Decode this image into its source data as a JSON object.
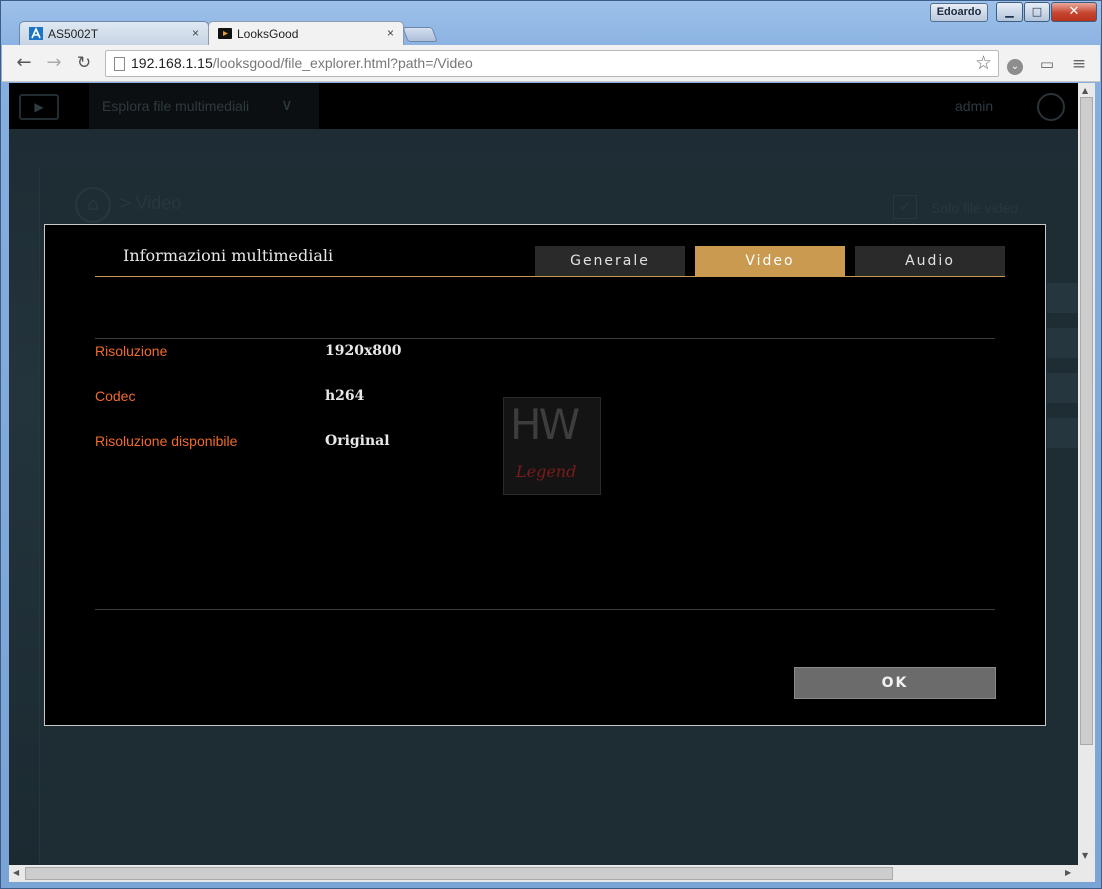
{
  "window": {
    "user_badge": "Edoardo",
    "minimize_glyph": "▁",
    "maximize_glyph": "□",
    "close_glyph": "✕"
  },
  "tabs": [
    {
      "label": "AS5002T",
      "icon": "asustor-icon",
      "close": "×"
    },
    {
      "label": "LooksGood",
      "icon": "looksgood-icon",
      "close": "×"
    }
  ],
  "toolbar": {
    "back_glyph": "←",
    "forward_glyph": "→",
    "reload_glyph": "↻",
    "url_host": "192.168.1.15",
    "url_path": "/looksgood/file_explorer.html?path=/Video",
    "star_glyph": "☆",
    "ext_glyph": "⌄",
    "cast_glyph": "▭",
    "menu_glyph": "≡"
  },
  "app": {
    "logo_glyph": "▶",
    "menu_label": "Esplora file multimediali",
    "menu_chevron": "∨",
    "user": "admin",
    "breadcrumb_home_glyph": "⌂",
    "breadcrumb": "> Video",
    "filter_check": "✓",
    "filter_label": "Solo file video"
  },
  "modal": {
    "title": "Informazioni multimediali",
    "tabs": [
      "Generale",
      "Video",
      "Audio"
    ],
    "active_tab": "Video",
    "rows": [
      {
        "label": "Risoluzione",
        "value": "1920x800"
      },
      {
        "label": "Codec",
        "value": "h264"
      },
      {
        "label": "Risoluzione disponibile",
        "value": "Original"
      }
    ],
    "watermark_top": "HW",
    "watermark_bottom": "Legend",
    "ok_label": "OK"
  },
  "colors": {
    "accent": "#c99a4f",
    "label": "#ef6c2a",
    "modal_bg": "#000000"
  }
}
